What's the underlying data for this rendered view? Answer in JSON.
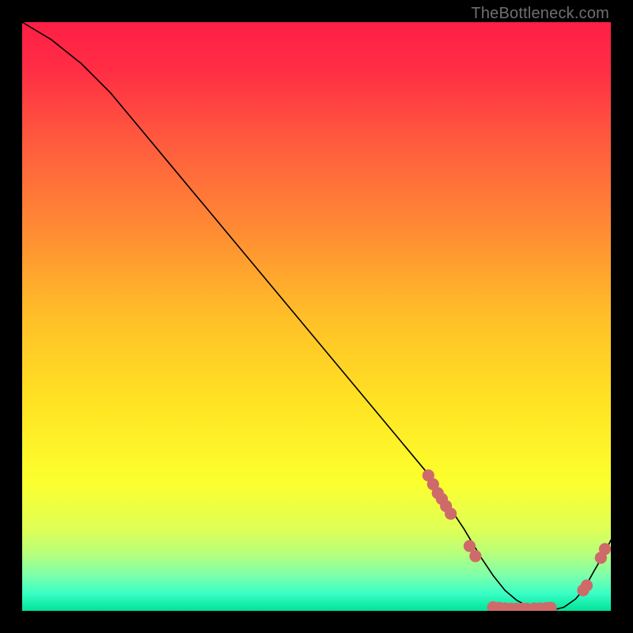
{
  "watermark": "TheBottleneck.com",
  "colors": {
    "curve_stroke": "#000000",
    "marker_fill": "#cf6a6a",
    "marker_stroke": "#cf6a6a",
    "gradient_stops": [
      {
        "offset": 0.0,
        "color": "#ff1e47"
      },
      {
        "offset": 0.08,
        "color": "#ff2d44"
      },
      {
        "offset": 0.2,
        "color": "#ff5a3e"
      },
      {
        "offset": 0.35,
        "color": "#ff8a34"
      },
      {
        "offset": 0.5,
        "color": "#ffbf28"
      },
      {
        "offset": 0.65,
        "color": "#ffe423"
      },
      {
        "offset": 0.78,
        "color": "#fcff2d"
      },
      {
        "offset": 0.86,
        "color": "#e0ff55"
      },
      {
        "offset": 0.9,
        "color": "#baff78"
      },
      {
        "offset": 0.94,
        "color": "#7dffab"
      },
      {
        "offset": 0.97,
        "color": "#3affc5"
      },
      {
        "offset": 1.0,
        "color": "#00e39a"
      }
    ]
  },
  "chart_data": {
    "type": "line",
    "title": "",
    "xlabel": "",
    "ylabel": "",
    "xlim": [
      0,
      100
    ],
    "ylim": [
      0,
      100
    ],
    "series": [
      {
        "name": "curve",
        "x": [
          0,
          5,
          10,
          15,
          20,
          25,
          30,
          35,
          40,
          45,
          50,
          55,
          60,
          65,
          70,
          73,
          75,
          78,
          80,
          82,
          84,
          86,
          88,
          90,
          92,
          94,
          95.5,
          97,
          99,
          100
        ],
        "y": [
          100,
          97,
          93,
          88,
          82,
          76,
          70,
          64,
          58,
          52,
          46,
          40,
          34,
          28,
          22,
          17,
          14,
          9,
          6,
          3.5,
          1.8,
          0.7,
          0.2,
          0.1,
          0.6,
          2.0,
          3.8,
          6.5,
          10,
          12
        ]
      }
    ],
    "markers": [
      {
        "x": 69.0,
        "y": 23.0
      },
      {
        "x": 69.8,
        "y": 21.5
      },
      {
        "x": 70.6,
        "y": 20.0
      },
      {
        "x": 71.3,
        "y": 19.0
      },
      {
        "x": 72.0,
        "y": 17.8
      },
      {
        "x": 72.8,
        "y": 16.5
      },
      {
        "x": 76.0,
        "y": 11.0
      },
      {
        "x": 77.0,
        "y": 9.3
      },
      {
        "x": 80.0,
        "y": 0.6
      },
      {
        "x": 81.0,
        "y": 0.5
      },
      {
        "x": 82.0,
        "y": 0.4
      },
      {
        "x": 83.0,
        "y": 0.35
      },
      {
        "x": 84.0,
        "y": 0.35
      },
      {
        "x": 85.0,
        "y": 0.35
      },
      {
        "x": 85.7,
        "y": 0.35
      },
      {
        "x": 87.0,
        "y": 0.4
      },
      {
        "x": 88.0,
        "y": 0.4
      },
      {
        "x": 89.0,
        "y": 0.45
      },
      {
        "x": 89.8,
        "y": 0.5
      },
      {
        "x": 95.3,
        "y": 3.5
      },
      {
        "x": 95.9,
        "y": 4.3
      },
      {
        "x": 98.3,
        "y": 9.0
      },
      {
        "x": 99.0,
        "y": 10.5
      }
    ]
  }
}
